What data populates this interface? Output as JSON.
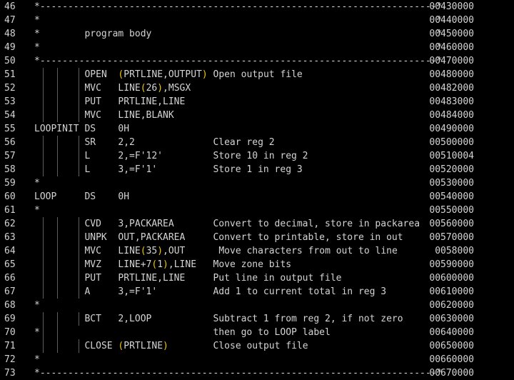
{
  "editor": {
    "lines": [
      {
        "num": "46",
        "code": "*-----------------------------------------------------------------------*",
        "seq": "00430000",
        "guides": 0
      },
      {
        "num": "47",
        "code": "*                                                                       *",
        "seq": "00440000",
        "guides": 0
      },
      {
        "num": "48",
        "code": "*        program body                                                   *",
        "seq": "00450000",
        "guides": 0
      },
      {
        "num": "49",
        "code": "*                                                                       *",
        "seq": "00460000",
        "guides": 0
      },
      {
        "num": "50",
        "code": "*-----------------------------------------------------------------------*",
        "seq": "00470000",
        "guides": 0
      },
      {
        "num": "51",
        "code": "         OPEN  (PRTLINE,OUTPUT) Open output file",
        "seq": "00480000",
        "guides": 3
      },
      {
        "num": "52",
        "code": "         MVC   LINE(26),MSGX",
        "seq": "00482000",
        "guides": 3
      },
      {
        "num": "53",
        "code": "         PUT   PRTLINE,LINE",
        "seq": "00483000",
        "guides": 3
      },
      {
        "num": "54",
        "code": "         MVC   LINE,BLANK",
        "seq": "00484000",
        "guides": 3
      },
      {
        "num": "55",
        "code": "LOOPINIT DS    0H",
        "seq": "00490000",
        "guides": 0
      },
      {
        "num": "56",
        "code": "         SR    2,2              Clear reg 2",
        "seq": "00500000",
        "guides": 3
      },
      {
        "num": "57",
        "code": "         L     2,=F'12'         Store 10 in reg 2",
        "seq": "00510004",
        "guides": 3
      },
      {
        "num": "58",
        "code": "         L     3,=F'1'          Store 1 in reg 3",
        "seq": "00520000",
        "guides": 3
      },
      {
        "num": "59",
        "code": "*",
        "seq": "00530000",
        "guides": 0
      },
      {
        "num": "60",
        "code": "LOOP     DS    0H",
        "seq": "00540000",
        "guides": 0
      },
      {
        "num": "61",
        "code": "*",
        "seq": "00550000",
        "guides": 0
      },
      {
        "num": "62",
        "code": "         CVD   3,PACKAREA       Convert to decimal, store in packarea",
        "seq": "00560000",
        "guides": 3
      },
      {
        "num": "63",
        "code": "         UNPK  OUT,PACKAREA     Convert to printable, store in out",
        "seq": "00570000",
        "guides": 3
      },
      {
        "num": "64",
        "code": "         MVC   LINE(35),OUT      Move characters from out to line",
        "seq": " 0058000",
        "guides": 3
      },
      {
        "num": "65",
        "code": "         MVZ   LINE+7(1),LINE   Move zone bits",
        "seq": "00590000",
        "guides": 3
      },
      {
        "num": "66",
        "code": "         PUT   PRTLINE,LINE     Put line in output file",
        "seq": "00600000",
        "guides": 3
      },
      {
        "num": "67",
        "code": "         A     3,=F'1'          Add 1 to current total in reg 3",
        "seq": "00610000",
        "guides": 3
      },
      {
        "num": "68",
        "code": "*",
        "seq": "00620000",
        "guides": 0
      },
      {
        "num": "69",
        "code": "         BCT   2,LOOP           Subtract 1 from reg 2, if not zero",
        "seq": "00630000",
        "guides": 3
      },
      {
        "num": "70",
        "code": "*                               then go to LOOP label",
        "seq": "00640000",
        "guides": 2
      },
      {
        "num": "71",
        "code": "         CLOSE (PRTLINE)        Close output file",
        "seq": "00650000",
        "guides": 3
      },
      {
        "num": "72",
        "code": "*",
        "seq": "00660000",
        "guides": 0
      },
      {
        "num": "73",
        "code": "*-----------------------------------------------------------------------*",
        "seq": "00670000",
        "guides": 0
      }
    ]
  }
}
